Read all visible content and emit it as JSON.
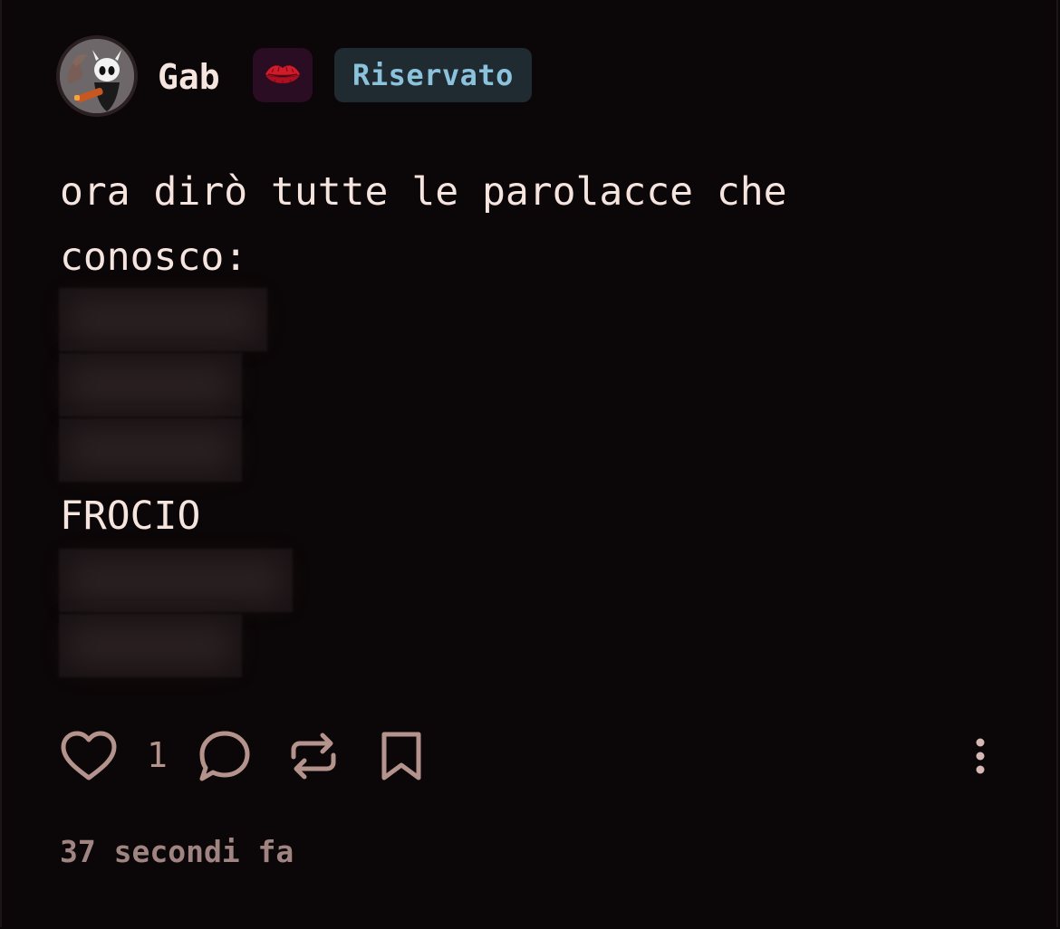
{
  "post": {
    "author": {
      "name": "Gab",
      "avatar_icon": "hollow-knight-avatar",
      "emoji_badge_icon": "kiss-mark-icon",
      "status_badge": "Riservato"
    },
    "text": "ora dirò tutte le parolacce che\nconosco:",
    "spoilers_hidden": 5,
    "visible_word": "FROCIO",
    "actions": {
      "like_count": "1",
      "like_icon": "heart-icon",
      "comment_icon": "comment-icon",
      "repost_icon": "repost-icon",
      "bookmark_icon": "bookmark-icon",
      "more_icon": "more-vertical-icon"
    },
    "timestamp": "37 secondi fa"
  },
  "colors": {
    "background": "#0b0607",
    "text": "#f6e4df",
    "icon": "#b4938c",
    "badge_text": "#8cc3dc",
    "badge_bg": "#1f2b31"
  }
}
